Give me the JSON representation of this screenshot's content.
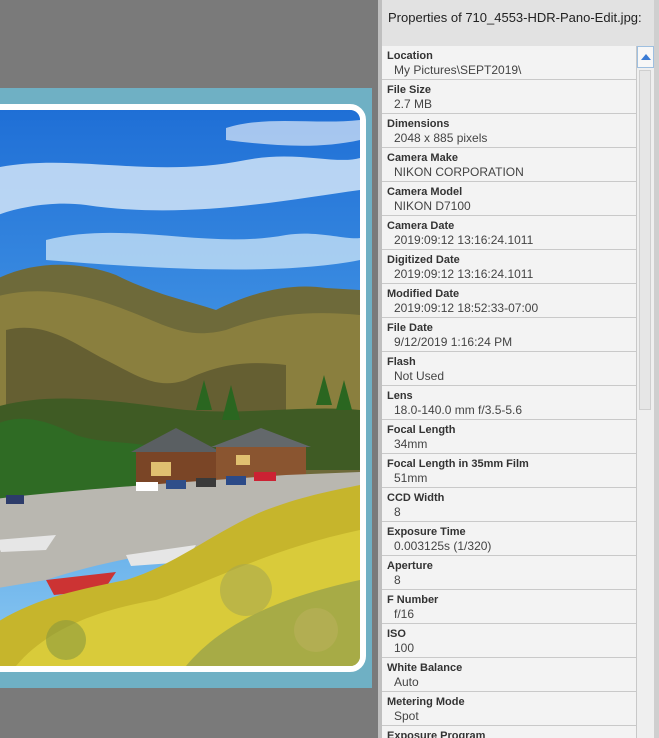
{
  "panel": {
    "title": "Properties of 710_4553-HDR-Pano-Edit.jpg:"
  },
  "properties": [
    {
      "name": "Location",
      "value": "My Pictures\\SEPT2019\\"
    },
    {
      "name": "File Size",
      "value": "2.7 MB"
    },
    {
      "name": "Dimensions",
      "value": "2048 x 885 pixels"
    },
    {
      "name": "Camera Make",
      "value": "NIKON CORPORATION"
    },
    {
      "name": "Camera Model",
      "value": "NIKON D7100"
    },
    {
      "name": "Camera Date",
      "value": "2019:09:12 13:16:24.1011"
    },
    {
      "name": "Digitized Date",
      "value": "2019:09:12 13:16:24.1011"
    },
    {
      "name": "Modified Date",
      "value": "2019:09:12 18:52:33-07:00"
    },
    {
      "name": "File Date",
      "value": "9/12/2019 1:16:24 PM"
    },
    {
      "name": "Flash",
      "value": "Not Used"
    },
    {
      "name": "Lens",
      "value": "18.0-140.0 mm f/3.5-5.6"
    },
    {
      "name": "Focal Length",
      "value": "34mm"
    },
    {
      "name": "Focal Length in 35mm Film",
      "value": "51mm"
    },
    {
      "name": "CCD Width",
      "value": "8"
    },
    {
      "name": "Exposure Time",
      "value": "0.003125s (1/320)"
    },
    {
      "name": "Aperture",
      "value": "8"
    },
    {
      "name": "F Number",
      "value": "f/16"
    },
    {
      "name": "ISO",
      "value": "100"
    },
    {
      "name": "White Balance",
      "value": "Auto"
    },
    {
      "name": "Metering Mode",
      "value": "Spot"
    },
    {
      "name": "Exposure Program",
      "value": ""
    }
  ],
  "icons": {
    "scroll_up": "chevron-up-icon"
  },
  "colors": {
    "frame_bg": "#6fb0c4",
    "panel_bg": "#d9d9d9",
    "scroll_arrow": "#3a7bd5"
  }
}
